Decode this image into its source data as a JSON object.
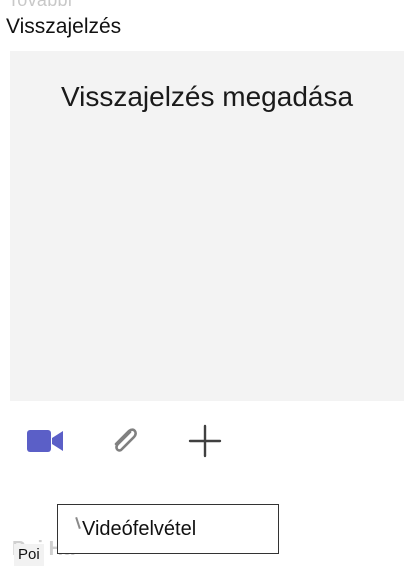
{
  "background_text": {
    "top": "További",
    "bottom": "Poi Ha"
  },
  "feedback": {
    "title": "Visszajelzés",
    "placeholder": "Visszajelzés megadása"
  },
  "toolbar": {
    "buttons": [
      {
        "name": "record-video-button",
        "icon": "video-camera-icon",
        "color": "#5b5fc7"
      },
      {
        "name": "attach-file-button",
        "icon": "paperclip-icon",
        "color": "#808080"
      },
      {
        "name": "add-button",
        "icon": "plus-icon",
        "color": "#404040"
      }
    ]
  },
  "tooltip": {
    "text": "Videófelvétel"
  },
  "chip": {
    "text": "Poi"
  },
  "colors": {
    "accent": "#5b5fc7",
    "input_background": "#f3f3f3"
  }
}
